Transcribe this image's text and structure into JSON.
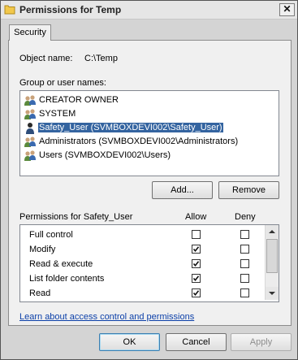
{
  "window": {
    "title": "Permissions for Temp"
  },
  "tabs": [
    {
      "label": "Security"
    }
  ],
  "object": {
    "label": "Object name:",
    "value": "C:\\Temp"
  },
  "groups": {
    "label": "Group or user names:",
    "items": [
      {
        "name": "CREATOR OWNER",
        "icon": "group-users-icon"
      },
      {
        "name": "SYSTEM",
        "icon": "group-users-icon"
      },
      {
        "name": "Safety_User (SVMBOXDEVI002\\Safety_User)",
        "icon": "single-user-icon",
        "selected": true
      },
      {
        "name": "Administrators (SVMBOXDEVI002\\Administrators)",
        "icon": "group-users-icon"
      },
      {
        "name": "Users (SVMBOXDEVI002\\Users)",
        "icon": "group-users-icon"
      }
    ],
    "add_label": "Add...",
    "remove_label": "Remove"
  },
  "permissions": {
    "header": "Permissions for Safety_User",
    "allow_label": "Allow",
    "deny_label": "Deny",
    "rows": [
      {
        "name": "Full control",
        "allow": false,
        "deny": false
      },
      {
        "name": "Modify",
        "allow": true,
        "deny": false
      },
      {
        "name": "Read & execute",
        "allow": true,
        "deny": false
      },
      {
        "name": "List folder contents",
        "allow": true,
        "deny": false
      },
      {
        "name": "Read",
        "allow": true,
        "deny": false
      }
    ]
  },
  "link": "Learn about access control and permissions",
  "footer": {
    "ok": "OK",
    "cancel": "Cancel",
    "apply": "Apply"
  }
}
